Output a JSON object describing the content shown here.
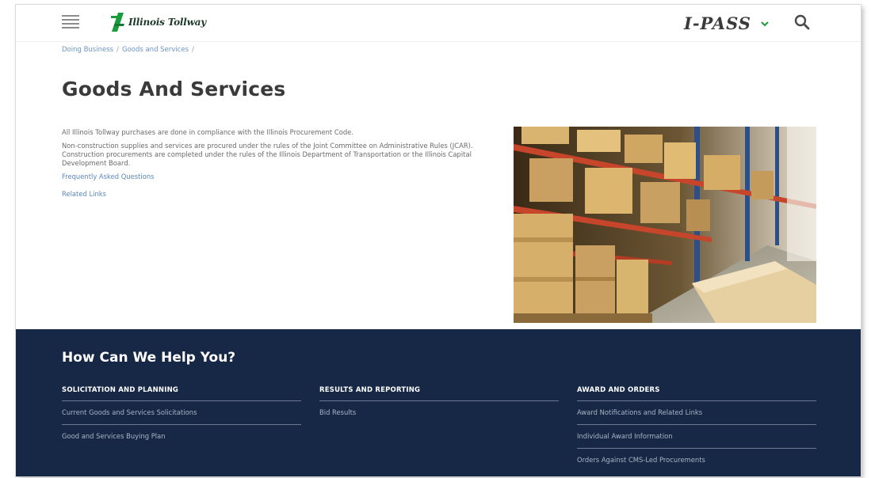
{
  "header": {
    "logo_text": "Illinois Tollway",
    "ipass_label": "I-PASS",
    "menu_icon": "hamburger-menu-icon",
    "search_icon": "search-icon",
    "dropdown_icon": "chevron-down-icon",
    "accent_color": "#1a9b3c"
  },
  "breadcrumb": {
    "items": [
      "Doing Business",
      "Goods and Services"
    ],
    "separator": "/"
  },
  "main": {
    "title": "Goods And Services",
    "paragraphs": [
      "All Illinois Tollway purchases are done in compliance with the Illinois Procurement Code.",
      "Non-construction supplies and services are procured under the rules of the Joint Committee on Administrative Rules (JCAR). Construction procurements are completed under the rules of the Illinois Department of Transportation or the Illinois Capital Development Board."
    ],
    "links": [
      "Frequently Asked Questions",
      "Related Links"
    ]
  },
  "help": {
    "title": "How Can We Help You?",
    "background_color": "#162845",
    "columns": [
      {
        "heading": "SOLICITATION AND PLANNING",
        "items": [
          "Current Goods and Services Solicitations",
          "Good and Services Buying Plan"
        ]
      },
      {
        "heading": "RESULTS AND REPORTING",
        "items": [
          "Bid Results"
        ]
      },
      {
        "heading": "AWARD AND ORDERS",
        "items": [
          "Award Notifications and Related Links",
          "Individual Award Information",
          "Orders Against CMS-Led Procurements"
        ]
      }
    ]
  }
}
